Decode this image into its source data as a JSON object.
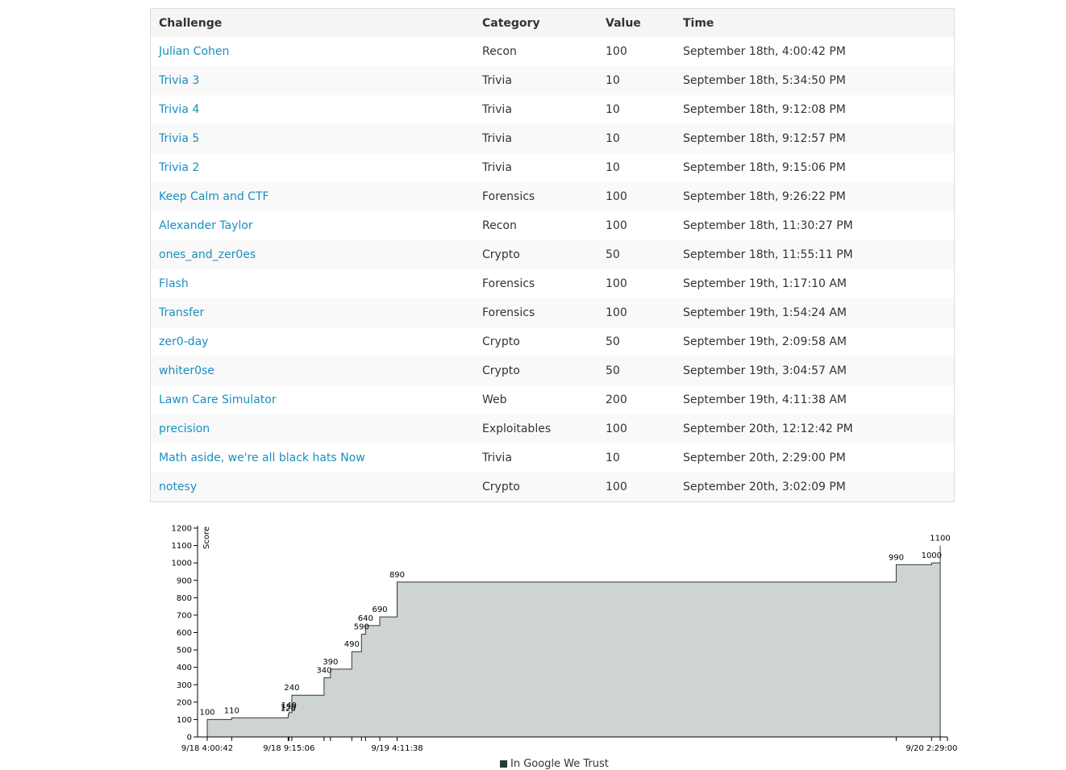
{
  "table": {
    "headers": [
      "Challenge",
      "Category",
      "Value",
      "Time"
    ],
    "rows": [
      {
        "challenge": "Julian Cohen",
        "category": "Recon",
        "value": "100",
        "time": "September 18th, 4:00:42 PM"
      },
      {
        "challenge": "Trivia 3",
        "category": "Trivia",
        "value": "10",
        "time": "September 18th, 5:34:50 PM"
      },
      {
        "challenge": "Trivia 4",
        "category": "Trivia",
        "value": "10",
        "time": "September 18th, 9:12:08 PM"
      },
      {
        "challenge": "Trivia 5",
        "category": "Trivia",
        "value": "10",
        "time": "September 18th, 9:12:57 PM"
      },
      {
        "challenge": "Trivia 2",
        "category": "Trivia",
        "value": "10",
        "time": "September 18th, 9:15:06 PM"
      },
      {
        "challenge": "Keep Calm and CTF",
        "category": "Forensics",
        "value": "100",
        "time": "September 18th, 9:26:22 PM"
      },
      {
        "challenge": "Alexander Taylor",
        "category": "Recon",
        "value": "100",
        "time": "September 18th, 11:30:27 PM"
      },
      {
        "challenge": "ones_and_zer0es",
        "category": "Crypto",
        "value": "50",
        "time": "September 18th, 11:55:11 PM"
      },
      {
        "challenge": "Flash",
        "category": "Forensics",
        "value": "100",
        "time": "September 19th, 1:17:10 AM"
      },
      {
        "challenge": "Transfer",
        "category": "Forensics",
        "value": "100",
        "time": "September 19th, 1:54:24 AM"
      },
      {
        "challenge": "zer0-day",
        "category": "Crypto",
        "value": "50",
        "time": "September 19th, 2:09:58 AM"
      },
      {
        "challenge": "whiter0se",
        "category": "Crypto",
        "value": "50",
        "time": "September 19th, 3:04:57 AM"
      },
      {
        "challenge": "Lawn Care Simulator",
        "category": "Web",
        "value": "200",
        "time": "September 19th, 4:11:38 AM"
      },
      {
        "challenge": "precision",
        "category": "Exploitables",
        "value": "100",
        "time": "September 20th, 12:12:42 PM"
      },
      {
        "challenge": "Math aside, we're all black hats Now",
        "category": "Trivia",
        "value": "10",
        "time": "September 20th, 2:29:00 PM"
      },
      {
        "challenge": "notesy",
        "category": "Crypto",
        "value": "100",
        "time": "September 20th, 3:02:09 PM"
      }
    ]
  },
  "colors": {
    "link": "#1a8fbf",
    "area_fill": "#ced4d4",
    "area_stroke": "#2b3b3b",
    "legend_swatch": "#243c35"
  },
  "chart_data": {
    "type": "area",
    "step": true,
    "ylabel": "Score",
    "ylim": [
      0,
      1200
    ],
    "yticks": [
      "0",
      "100",
      "200",
      "300",
      "400",
      "500",
      "600",
      "700",
      "800",
      "900",
      "1000",
      "1100",
      "1200"
    ],
    "xtick_labels": [
      "9/18 4:00:42",
      "9/18 9:15:06",
      "9/19 4:11:38",
      "9/20 2:29:00"
    ],
    "legend": [
      "In Google We Trust"
    ],
    "points": [
      {
        "x": "2015-09-18T16:00:42",
        "y": 100,
        "label": "100"
      },
      {
        "x": "2015-09-18T17:34:50",
        "y": 110,
        "label": "110"
      },
      {
        "x": "2015-09-18T21:12:08",
        "y": 120,
        "label": "120"
      },
      {
        "x": "2015-09-18T21:12:57",
        "y": 130,
        "label": "130"
      },
      {
        "x": "2015-09-18T21:15:06",
        "y": 140,
        "label": "140"
      },
      {
        "x": "2015-09-18T21:26:22",
        "y": 240,
        "label": "240"
      },
      {
        "x": "2015-09-18T23:30:27",
        "y": 340,
        "label": "340"
      },
      {
        "x": "2015-09-18T23:55:11",
        "y": 390,
        "label": "390"
      },
      {
        "x": "2015-09-19T01:17:10",
        "y": 490,
        "label": "490"
      },
      {
        "x": "2015-09-19T01:54:24",
        "y": 590,
        "label": "590"
      },
      {
        "x": "2015-09-19T02:09:58",
        "y": 640,
        "label": "640"
      },
      {
        "x": "2015-09-19T03:04:57",
        "y": 690,
        "label": "690"
      },
      {
        "x": "2015-09-19T04:11:38",
        "y": 890,
        "label": "890"
      },
      {
        "x": "2015-09-20T12:12:42",
        "y": 990,
        "label": "990"
      },
      {
        "x": "2015-09-20T14:29:00",
        "y": 1000,
        "label": "1000"
      },
      {
        "x": "2015-09-20T15:02:09",
        "y": 1100,
        "label": "1100"
      }
    ]
  }
}
